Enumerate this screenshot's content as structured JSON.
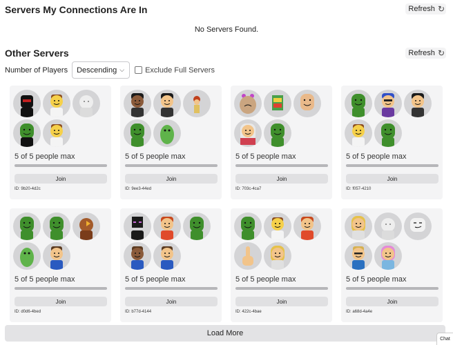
{
  "connections": {
    "title": "Servers My Connections Are In",
    "refresh_label": "Refresh",
    "empty_message": "No Servers Found."
  },
  "other": {
    "title": "Other Servers",
    "refresh_label": "Refresh",
    "filter_label": "Number of Players",
    "sort_selected": "Descending",
    "exclude_full_label": "Exclude Full Servers",
    "exclude_full_checked": false
  },
  "servers": [
    {
      "players_text": "5 of 5 people max",
      "fill_fraction": 1.0,
      "join_label": "Join",
      "id_text": "ID: 9b20-4d2c",
      "avatars": [
        "avatar-black-red-hoodie",
        "avatar-noob-brown-hair",
        "avatar-white-cat",
        "avatar-green-smiley-black-shirt",
        "avatar-noob-brown-hair"
      ]
    },
    {
      "players_text": "5 of 5 people max",
      "fill_fraction": 1.0,
      "join_label": "Join",
      "id_text": "ID: 9ee3-44ed",
      "avatars": [
        "avatar-dark-hair-glasses",
        "avatar-black-hair",
        "avatar-small-red-hair",
        "avatar-green-smiley",
        "avatar-green-zombie-plush"
      ]
    },
    {
      "players_text": "5 of 5 people max",
      "fill_fraction": 1.0,
      "join_label": "Join",
      "id_text": "ID: 703c-4ca7",
      "avatars": [
        "avatar-pink-bow-big-head",
        "avatar-colorful-robot",
        "avatar-bald-smiley",
        "avatar-red-keffiyeh",
        "avatar-green-smiley"
      ]
    },
    {
      "players_text": "5 of 5 people max",
      "fill_fraction": 1.0,
      "join_label": "Join",
      "id_text": "ID: f057-4210",
      "avatars": [
        "avatar-green-smiley",
        "avatar-blue-hair-glasses",
        "avatar-black-hair-face",
        "avatar-noob-brown-hair",
        "avatar-green-smiley"
      ]
    },
    {
      "players_text": "5 of 5 people max",
      "fill_fraction": 1.0,
      "join_label": "Join",
      "id_text": "ID: d0d6-4bed",
      "avatars": [
        "avatar-green-smiley",
        "avatar-green-smiley",
        "avatar-chicken",
        "avatar-green-dino",
        "avatar-blue-shirt-kid"
      ]
    },
    {
      "players_text": "5 of 5 people max",
      "fill_fraction": 1.0,
      "join_label": "Join",
      "id_text": "ID: b77d-4144",
      "avatars": [
        "avatar-enderman",
        "avatar-red-hair-girl",
        "avatar-green-smiley",
        "avatar-dark-skin-brown-hair",
        "avatar-sword-fighter"
      ]
    },
    {
      "players_text": "5 of 5 people max",
      "fill_fraction": 1.0,
      "join_label": "Join",
      "id_text": "ID: 422c-4bae",
      "avatars": [
        "avatar-green-smiley",
        "avatar-noob-brown-hair",
        "avatar-red-hair-noob",
        "avatar-finger-hand",
        "avatar-blonde-girl"
      ]
    },
    {
      "players_text": "5 of 5 people max",
      "fill_fraction": 1.0,
      "join_label": "Join",
      "id_text": "ID: a68d-4a4e",
      "avatars": [
        "avatar-blonde-girl",
        "avatar-white-character",
        "avatar-white-smug-face",
        "avatar-glasses-kid",
        "avatar-pink-hair-girl"
      ]
    }
  ],
  "load_more_label": "Load More",
  "chat_label": "Chat",
  "colors": {
    "green_avatar": "#3f8f2c",
    "card_bg": "#f4f4f5",
    "avatar_bg": "#d4d4d6"
  }
}
